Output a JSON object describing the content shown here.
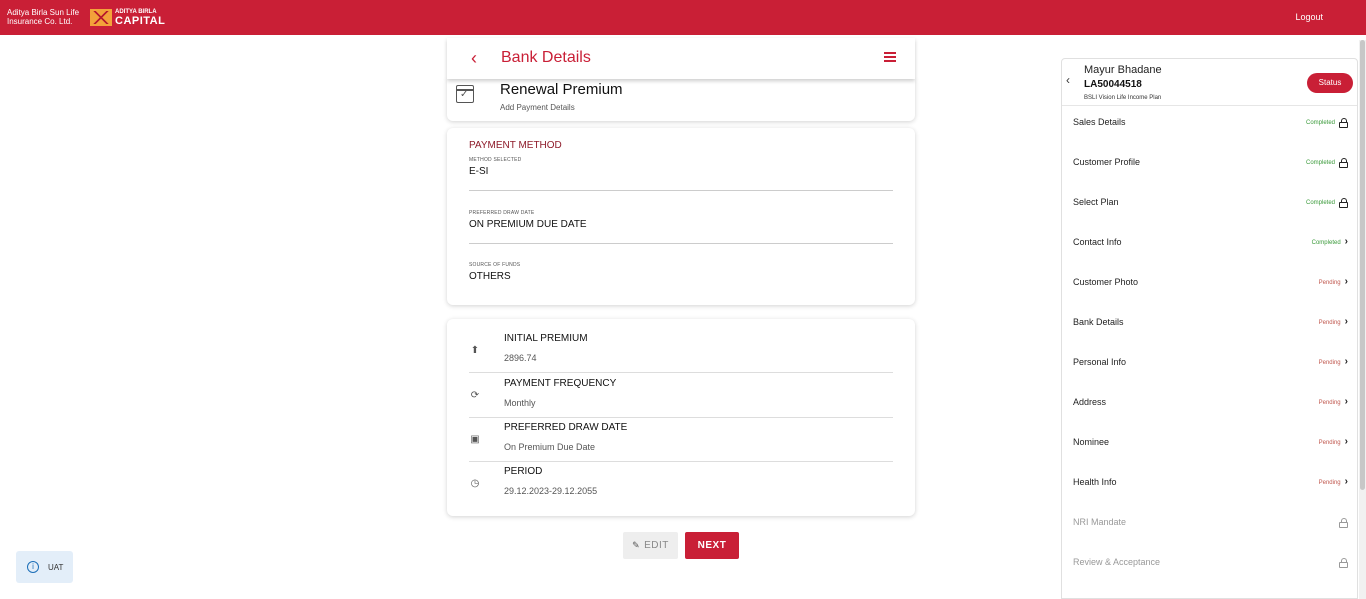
{
  "topbar": {
    "brand_line1": "Aditya Birla Sun Life",
    "brand_line2": "Insurance Co. Ltd.",
    "logo_small": "ADITYA BIRLA",
    "logo_big": "CAPITAL",
    "logout": "Logout"
  },
  "header": {
    "title": "Bank Details"
  },
  "renewal": {
    "title": "Renewal Premium",
    "subtitle": "Add Payment Details"
  },
  "payment": {
    "section_title": "PAYMENT METHOD",
    "fields": [
      {
        "label": "METHOD SELECTED",
        "value": "E-SI"
      },
      {
        "label": "PREFERRED DRAW DATE",
        "value": "ON PREMIUM DUE DATE"
      },
      {
        "label": "SOURCE OF FUNDS",
        "value": "OTHERS"
      }
    ]
  },
  "summary": [
    {
      "icon": "arrow-up-circle-icon",
      "label": "INITIAL PREMIUM",
      "value": "2896.74"
    },
    {
      "icon": "refresh-icon",
      "label": "PAYMENT FREQUENCY",
      "value": "Monthly"
    },
    {
      "icon": "calendar-check-icon",
      "label": "PREFERRED DRAW DATE",
      "value": "On Premium Due Date"
    },
    {
      "icon": "clock-icon",
      "label": "PERIOD",
      "value": "29.12.2023-29.12.2055"
    }
  ],
  "actions": {
    "edit": "EDIT",
    "next": "NEXT"
  },
  "env_badge": "UAT",
  "sidebar": {
    "name": "Mayur Bhadane",
    "app_id": "LA50044518",
    "plan": "BSLI Vision Life Income Plan",
    "status_button": "Status",
    "items": [
      {
        "label": "Sales Details",
        "status": "Completed",
        "kind": "lock",
        "status_color": "#3a9a3a"
      },
      {
        "label": "Customer Profile",
        "status": "Completed",
        "kind": "lock",
        "status_color": "#3a9a3a"
      },
      {
        "label": "Select Plan",
        "status": "Completed",
        "kind": "lock",
        "status_color": "#3a9a3a"
      },
      {
        "label": "Contact Info",
        "status": "Completed",
        "kind": "arrow",
        "status_color": "#3a9a3a"
      },
      {
        "label": "Customer Photo",
        "status": "Pending",
        "kind": "arrow",
        "status_color": "#c0584f"
      },
      {
        "label": "Bank Details",
        "status": "Pending",
        "kind": "arrow",
        "status_color": "#c0584f"
      },
      {
        "label": "Personal Info",
        "status": "Pending",
        "kind": "arrow",
        "status_color": "#c0584f"
      },
      {
        "label": "Address",
        "status": "Pending",
        "kind": "arrow",
        "status_color": "#c0584f"
      },
      {
        "label": "Nominee",
        "status": "Pending",
        "kind": "arrow",
        "status_color": "#c0584f"
      },
      {
        "label": "Health Info",
        "status": "Pending",
        "kind": "arrow",
        "status_color": "#c0584f"
      },
      {
        "label": "NRI Mandate",
        "status": "",
        "kind": "disabled-lock",
        "status_color": "#999999"
      },
      {
        "label": "Review & Acceptance",
        "status": "",
        "kind": "disabled-lock",
        "status_color": "#999999"
      }
    ]
  },
  "colors": {
    "brand_red": "#c91f36",
    "completed": "#3a9a3a",
    "pending": "#c0584f"
  }
}
